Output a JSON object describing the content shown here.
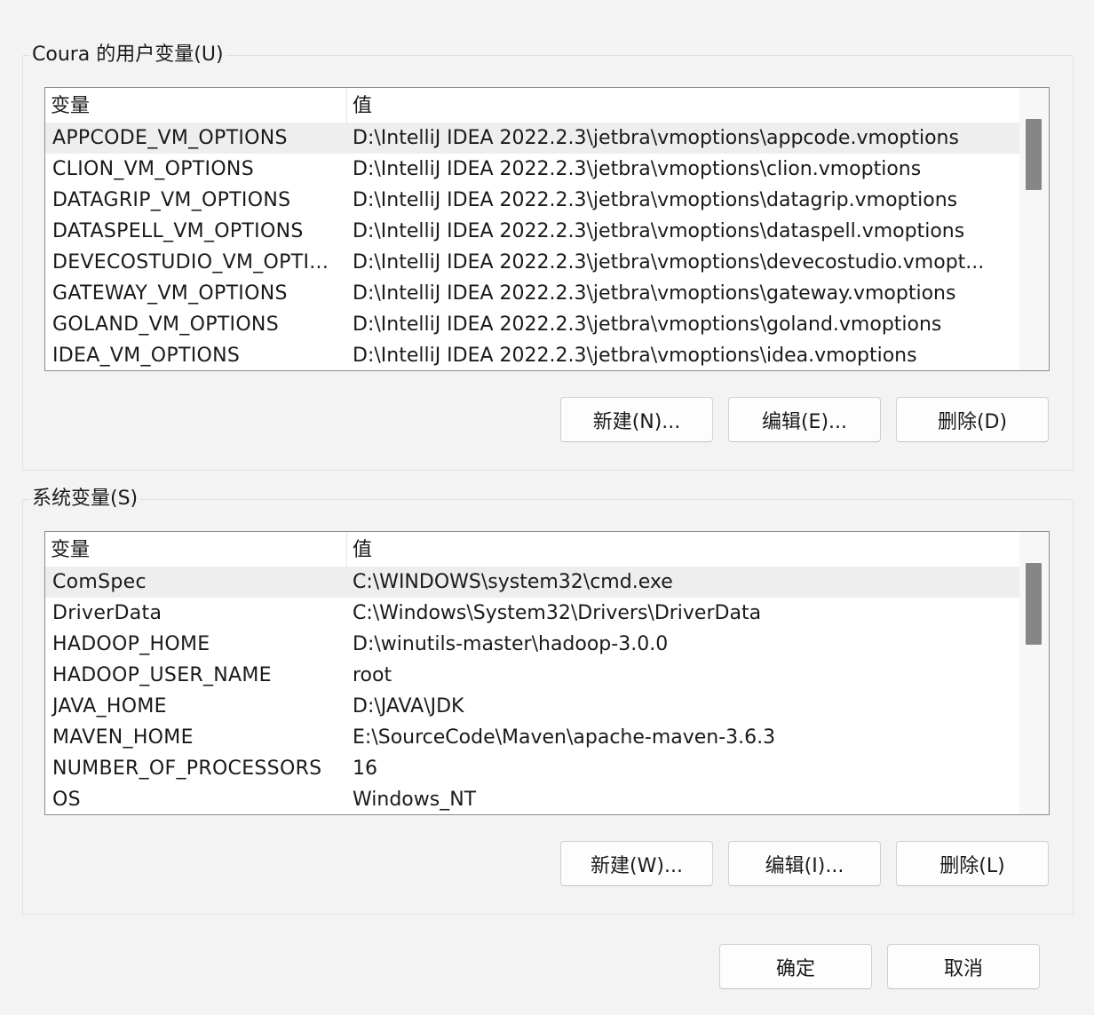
{
  "user_vars": {
    "title": "Coura 的用户变量(U)",
    "columns": {
      "name": "变量",
      "value": "值"
    },
    "rows": [
      {
        "name": "APPCODE_VM_OPTIONS",
        "value": "D:\\IntelliJ IDEA 2022.2.3\\jetbra\\vmoptions\\appcode.vmoptions"
      },
      {
        "name": "CLION_VM_OPTIONS",
        "value": "D:\\IntelliJ IDEA 2022.2.3\\jetbra\\vmoptions\\clion.vmoptions"
      },
      {
        "name": "DATAGRIP_VM_OPTIONS",
        "value": "D:\\IntelliJ IDEA 2022.2.3\\jetbra\\vmoptions\\datagrip.vmoptions"
      },
      {
        "name": "DATASPELL_VM_OPTIONS",
        "value": "D:\\IntelliJ IDEA 2022.2.3\\jetbra\\vmoptions\\dataspell.vmoptions"
      },
      {
        "name": "DEVECOSTUDIO_VM_OPTI...",
        "value": "D:\\IntelliJ IDEA 2022.2.3\\jetbra\\vmoptions\\devecostudio.vmopt..."
      },
      {
        "name": "GATEWAY_VM_OPTIONS",
        "value": "D:\\IntelliJ IDEA 2022.2.3\\jetbra\\vmoptions\\gateway.vmoptions"
      },
      {
        "name": "GOLAND_VM_OPTIONS",
        "value": "D:\\IntelliJ IDEA 2022.2.3\\jetbra\\vmoptions\\goland.vmoptions"
      },
      {
        "name": "IDEA_VM_OPTIONS",
        "value": "D:\\IntelliJ IDEA 2022.2.3\\jetbra\\vmoptions\\idea.vmoptions"
      }
    ],
    "buttons": {
      "new": "新建(N)...",
      "edit": "编辑(E)...",
      "delete": "删除(D)"
    }
  },
  "system_vars": {
    "title": "系统变量(S)",
    "columns": {
      "name": "变量",
      "value": "值"
    },
    "rows": [
      {
        "name": "ComSpec",
        "value": "C:\\WINDOWS\\system32\\cmd.exe"
      },
      {
        "name": "DriverData",
        "value": "C:\\Windows\\System32\\Drivers\\DriverData"
      },
      {
        "name": "HADOOP_HOME",
        "value": "D:\\winutils-master\\hadoop-3.0.0"
      },
      {
        "name": "HADOOP_USER_NAME",
        "value": "root"
      },
      {
        "name": "JAVA_HOME",
        "value": "D:\\JAVA\\JDK"
      },
      {
        "name": "MAVEN_HOME",
        "value": "E:\\SourceCode\\Maven\\apache-maven-3.6.3"
      },
      {
        "name": "NUMBER_OF_PROCESSORS",
        "value": "16"
      },
      {
        "name": "OS",
        "value": "Windows_NT"
      }
    ],
    "buttons": {
      "new": "新建(W)...",
      "edit": "编辑(I)...",
      "delete": "删除(L)"
    }
  },
  "dialog_buttons": {
    "ok": "确定",
    "cancel": "取消"
  }
}
